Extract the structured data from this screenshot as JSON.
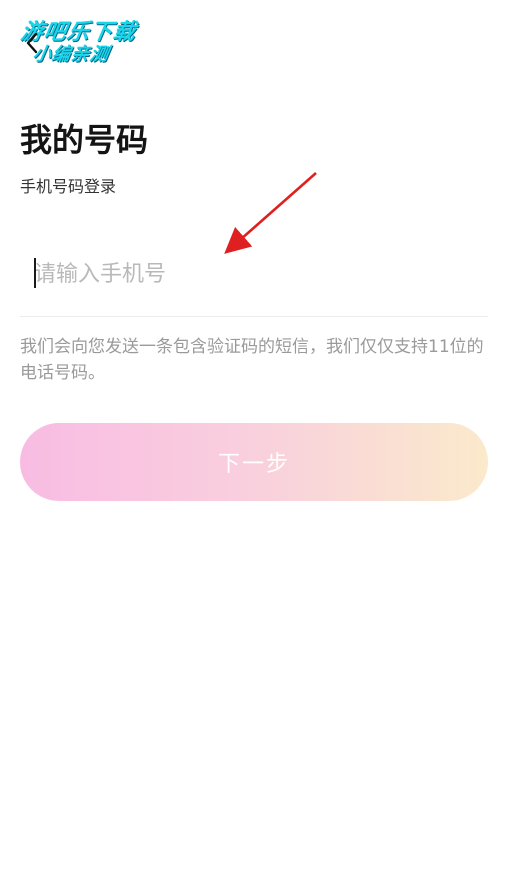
{
  "watermark": {
    "line1": "游吧乐下载",
    "line2": "小编亲测"
  },
  "header": {
    "back_icon": "chevron-left-icon"
  },
  "main": {
    "title": "我的号码",
    "subtitle": "手机号码登录",
    "phone_input": {
      "placeholder": "请输入手机号",
      "value": ""
    },
    "notice": "我们会向您发送一条包含验证码的短信，我们仅仅支持11位的电话号码。",
    "next_button_label": "下一步"
  },
  "colors": {
    "button_gradient_start": "#f7b0de",
    "button_gradient_end": "#fae6c2",
    "annotation_arrow": "#e02020"
  }
}
